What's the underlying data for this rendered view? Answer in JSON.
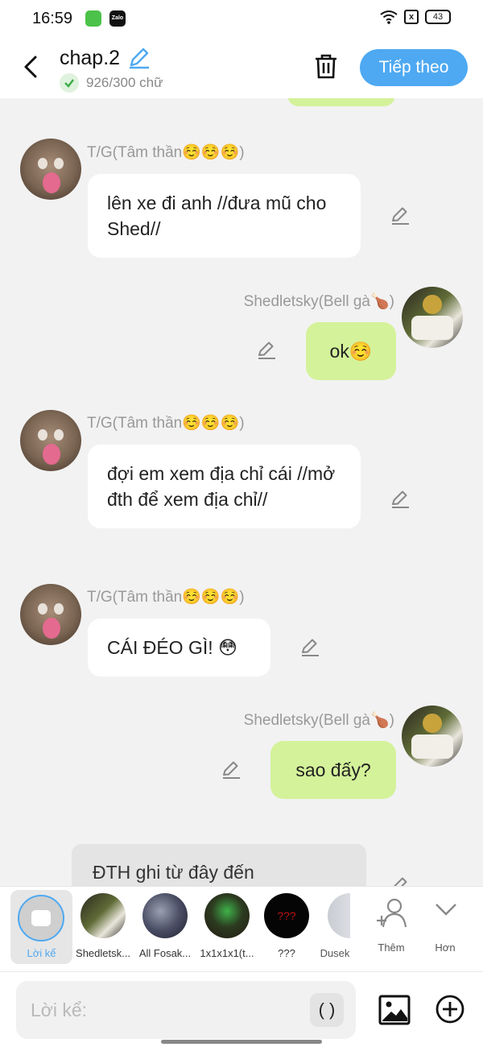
{
  "status": {
    "time": "16:59",
    "app2": "Zalo",
    "sim": "x",
    "battery": "43"
  },
  "header": {
    "title": "chap.2",
    "word_count": "926/300 chữ",
    "next_label": "Tiếp theo"
  },
  "messages": [
    {
      "name": "T/G(Tâm thần☺️☺️☺️)",
      "text": "lên xe đi anh //đưa mũ cho Shed//"
    },
    {
      "name": "Shedletsky(Bell gà🍗)",
      "text": "ok☺️"
    },
    {
      "name": "T/G(Tâm thần☺️☺️☺️)",
      "text": "đợi em xem địa chỉ cái //mở đth để xem địa chỉ//"
    },
    {
      "name": "T/G(Tâm thần☺️☺️☺️)",
      "text": "CÁI ĐÉO GÌ! 😳"
    },
    {
      "name": "Shedletsky(Bell gà🍗)",
      "text": "sao đấy?"
    }
  ],
  "narration": {
    "text": "ĐTH ghi từ đây đến"
  },
  "characters": [
    {
      "label": "Lời kể"
    },
    {
      "label": "Shedletsk..."
    },
    {
      "label": "All Fosak..."
    },
    {
      "label": "1x1x1x1(t..."
    },
    {
      "label": "???",
      "badge": "???"
    },
    {
      "label": "Dusek"
    },
    {
      "label": "Thêm"
    },
    {
      "label": "Hơn"
    }
  ],
  "input": {
    "placeholder": "Lời kể:",
    "paren": "( )"
  },
  "colors": {
    "accent": "#4ea9f2",
    "bubble_right": "#d4f29a",
    "bubble_left": "#ffffff",
    "background": "#f2f2f2"
  }
}
